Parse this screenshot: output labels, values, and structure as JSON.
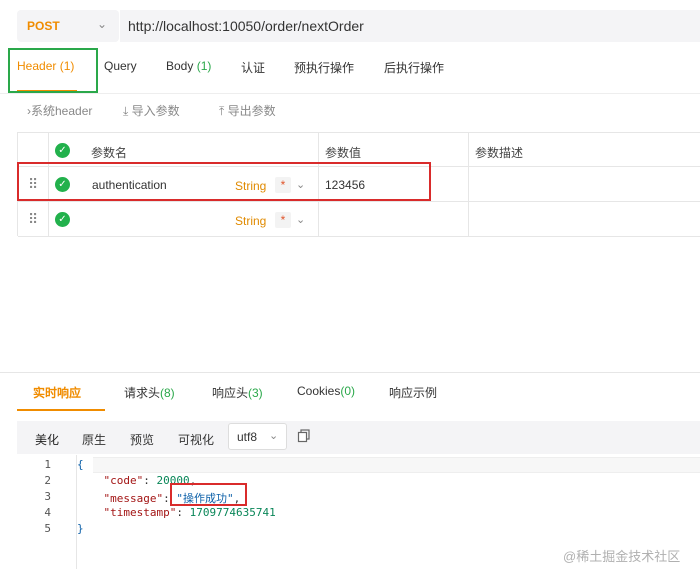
{
  "request": {
    "method": "POST",
    "url": "http://localhost:10050/order/nextOrder"
  },
  "tabs": [
    {
      "label": "Header",
      "count": " (1)"
    },
    {
      "label": "Query",
      "count": ""
    },
    {
      "label": "Body",
      "count": " (1)"
    },
    {
      "label": "认证",
      "count": ""
    },
    {
      "label": "预执行操作",
      "count": ""
    },
    {
      "label": "后执行操作",
      "count": ""
    }
  ],
  "toolbar": {
    "system_header": "系统header",
    "import": "导入参数",
    "export": "导出参数"
  },
  "table": {
    "headers": {
      "name": "参数名",
      "value": "参数值",
      "desc": "参数描述"
    },
    "rows": [
      {
        "name": "authentication",
        "type": "String",
        "required": "*",
        "value": "123456",
        "desc": ""
      },
      {
        "name": "",
        "type": "String",
        "required": "*",
        "value": "",
        "desc": ""
      }
    ]
  },
  "response": {
    "tabs": [
      {
        "label": "实时响应",
        "count": ""
      },
      {
        "label": "请求头",
        "count": "(8)"
      },
      {
        "label": "响应头",
        "count": "(3)"
      },
      {
        "label": "Cookies",
        "count": "(0)"
      },
      {
        "label": "响应示例",
        "count": ""
      }
    ],
    "view_modes": [
      "美化",
      "原生",
      "预览",
      "可视化"
    ],
    "encoding": "utf8",
    "body": {
      "line_numbers": [
        "1",
        "2",
        "3",
        "4",
        "5"
      ],
      "open": "{",
      "close": "}",
      "code_key": "\"code\"",
      "code_val": "20000",
      "message_key": "\"message\"",
      "message_val": "\"操作成功\"",
      "timestamp_key": "\"timestamp\"",
      "timestamp_val": "1709774635741"
    }
  },
  "watermark": "@稀土掘金技术社区",
  "colors": {
    "accent": "#f08c00",
    "success": "#22b14c",
    "highlight_red": "#d92b2b",
    "highlight_green": "#2aa84a"
  }
}
